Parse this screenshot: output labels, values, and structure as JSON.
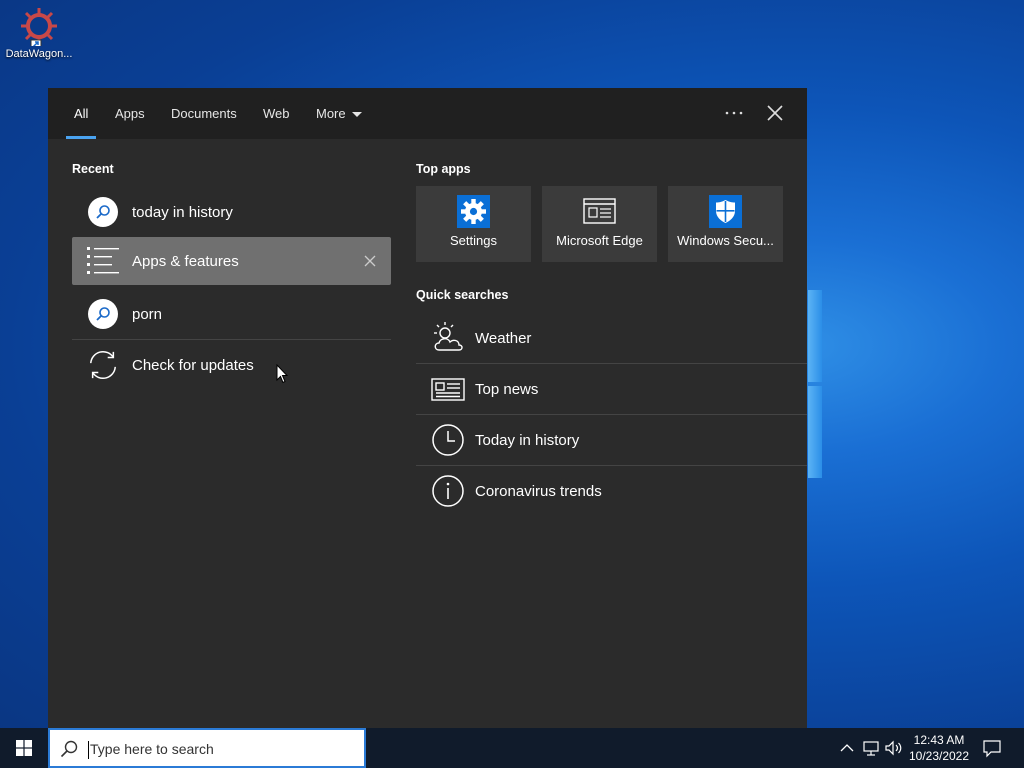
{
  "desktop": {
    "icon_label": "DataWagon..."
  },
  "search_panel": {
    "tabs": [
      {
        "label": "All",
        "active": true
      },
      {
        "label": "Apps"
      },
      {
        "label": "Documents"
      },
      {
        "label": "Web"
      },
      {
        "label": "More"
      }
    ],
    "recent": {
      "title": "Recent",
      "items": [
        {
          "label": "today in history",
          "icon": "search-icon"
        },
        {
          "label": "Apps & features",
          "icon": "list-icon",
          "selected": true
        },
        {
          "label": "porn",
          "icon": "search-icon"
        },
        {
          "label": "Check for updates",
          "icon": "refresh-icon"
        }
      ]
    },
    "top_apps": {
      "title": "Top apps",
      "items": [
        {
          "label": "Settings",
          "icon": "gear-icon"
        },
        {
          "label": "Microsoft Edge",
          "icon": "browser-window-icon"
        },
        {
          "label": "Windows Secu...",
          "icon": "shield-icon"
        }
      ]
    },
    "quick_searches": {
      "title": "Quick searches",
      "items": [
        {
          "label": "Weather",
          "icon": "weather-icon"
        },
        {
          "label": "Top news",
          "icon": "newspaper-icon"
        },
        {
          "label": "Today in history",
          "icon": "clock-icon"
        },
        {
          "label": "Coronavirus trends",
          "icon": "info-icon"
        }
      ]
    },
    "accent_color": "#4aa3f0"
  },
  "taskbar": {
    "search_placeholder": "Type here to search",
    "time": "12:43 AM",
    "date": "10/23/2022"
  }
}
